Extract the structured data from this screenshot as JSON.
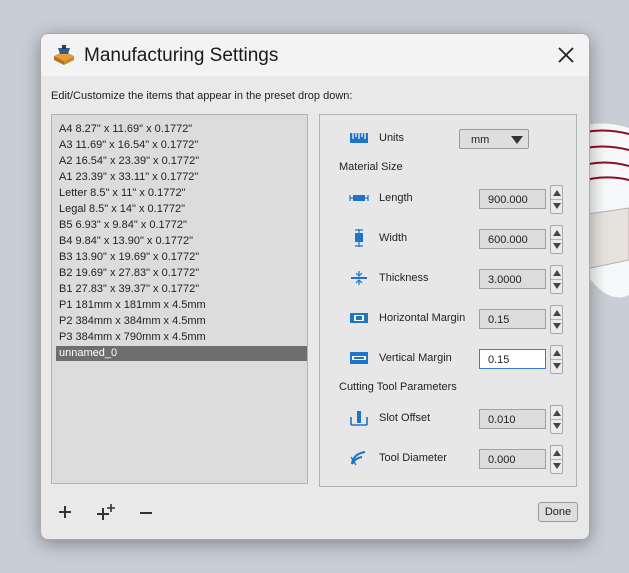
{
  "dialog": {
    "title": "Manufacturing Settings",
    "instruction": "Edit/Customize the items that appear in the preset drop down:"
  },
  "presets": [
    "A4 8.27\" x 11.69\" x 0.1772\"",
    "A3 11.69\" x 16.54\" x 0.1772\"",
    "A2 16.54\" x 23.39\" x 0.1772\"",
    "A1 23.39\" x 33.11\" x 0.1772\"",
    "Letter 8.5\" x 11\" x 0.1772\"",
    "Legal 8.5\" x 14\" x 0.1772\"",
    "B5 6.93\" x 9.84\" x 0.1772\"",
    "B4 9.84\" x 13.90\" x 0.1772\"",
    "B3 13.90\" x 19.69\" x 0.1772\"",
    "B2 19.69\" x 27.83\" x 0.1772\"",
    "B1 27.83\" x 39.37\" x 0.1772\"",
    "P1 181mm x 181mm x 4.5mm",
    "P2 384mm x 384mm x 4.5mm",
    "P3 384mm x 790mm x 4.5mm",
    "unnamed_0"
  ],
  "selected_preset": "unnamed_0",
  "settings": {
    "units_label": "Units",
    "units_value": "mm",
    "material_size_heading": "Material Size",
    "length_label": "Length",
    "length_value": "900.000",
    "width_label": "Width",
    "width_value": "600.000",
    "thickness_label": "Thickness",
    "thickness_value": "3.0000",
    "hmargin_label": "Horizontal Margin",
    "hmargin_value": "0.15",
    "vmargin_label": "Vertical Margin",
    "vmargin_value": "0.15",
    "cutting_tool_heading": "Cutting Tool Parameters",
    "slot_offset_label": "Slot Offset",
    "slot_offset_value": "0.010",
    "tool_diameter_label": "Tool Diameter",
    "tool_diameter_value": "0.000"
  },
  "buttons": {
    "done": "Done"
  },
  "icons": {
    "app": "laser-box-icon",
    "close": "close-icon",
    "add": "plus-icon",
    "add_copy": "plus-plus-icon",
    "remove": "minus-icon"
  },
  "colors": {
    "accent_blue": "#1e74c8",
    "selected_row": "#6e6e6e",
    "focus_border": "#3a7bd5"
  }
}
